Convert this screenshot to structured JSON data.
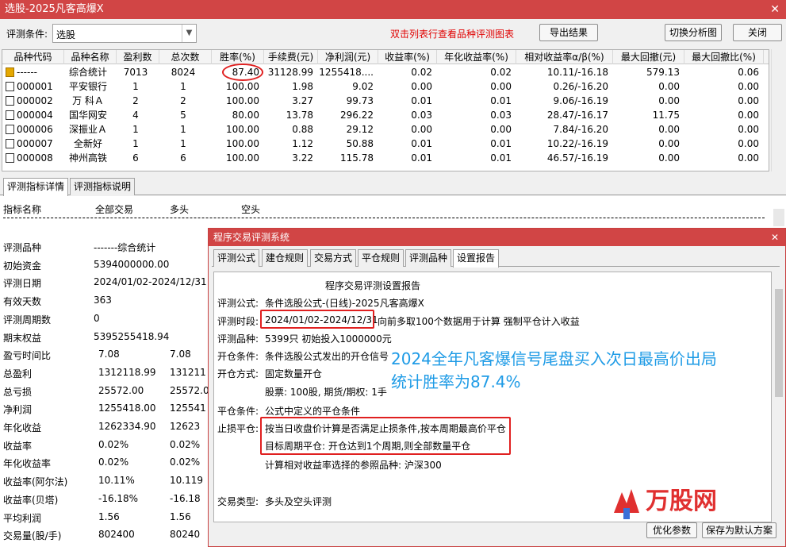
{
  "window": {
    "title": "选股-2025凡客高爆X",
    "close": "✕"
  },
  "toolbar": {
    "label": "评测条件:",
    "select_value": "选股",
    "hint": "双击列表行查看品种评测图表",
    "export_btn": "导出结果",
    "switch_btn": "切换分析图",
    "close_btn": "关闭"
  },
  "grid": {
    "columns": [
      "品种代码",
      "品种名称",
      "盈利数",
      "总次数",
      "胜率(%)",
      "手续费(元)",
      "净利润(元)",
      "收益率(%)",
      "年化收益率(%)",
      "相对收益率α/β(%)",
      "最大回撤(元)",
      "最大回撤比(%)"
    ],
    "rows": [
      {
        "code": "------",
        "name": "综合统计",
        "win": "7013",
        "total": "8024",
        "rate": "87.40",
        "fee": "31128.99",
        "profit": "1255418....",
        "ret": "0.02",
        "annual": "0.02",
        "alpha": "10.11/-16.18",
        "maxdd": "579.13",
        "ddratio": "0.06",
        "summary": true
      },
      {
        "code": "000001",
        "name": "平安银行",
        "win": "1",
        "total": "1",
        "rate": "100.00",
        "fee": "1.98",
        "profit": "9.02",
        "ret": "0.00",
        "annual": "0.00",
        "alpha": "0.26/-16.20",
        "maxdd": "0.00",
        "ddratio": "0.00"
      },
      {
        "code": "000002",
        "name": "万 科Ａ",
        "win": "2",
        "total": "2",
        "rate": "100.00",
        "fee": "3.27",
        "profit": "99.73",
        "ret": "0.01",
        "annual": "0.01",
        "alpha": "9.06/-16.19",
        "maxdd": "0.00",
        "ddratio": "0.00"
      },
      {
        "code": "000004",
        "name": "国华网安",
        "win": "4",
        "total": "5",
        "rate": "80.00",
        "fee": "13.78",
        "profit": "296.22",
        "ret": "0.03",
        "annual": "0.03",
        "alpha": "28.47/-16.17",
        "maxdd": "11.75",
        "ddratio": "0.00"
      },
      {
        "code": "000006",
        "name": "深振业Ａ",
        "win": "1",
        "total": "1",
        "rate": "100.00",
        "fee": "0.88",
        "profit": "29.12",
        "ret": "0.00",
        "annual": "0.00",
        "alpha": "7.84/-16.20",
        "maxdd": "0.00",
        "ddratio": "0.00"
      },
      {
        "code": "000007",
        "name": "全新好",
        "win": "1",
        "total": "1",
        "rate": "100.00",
        "fee": "1.12",
        "profit": "50.88",
        "ret": "0.01",
        "annual": "0.01",
        "alpha": "10.22/-16.19",
        "maxdd": "0.00",
        "ddratio": "0.00"
      },
      {
        "code": "000008",
        "name": "神州高铁",
        "win": "6",
        "total": "6",
        "rate": "100.00",
        "fee": "3.22",
        "profit": "115.78",
        "ret": "0.01",
        "annual": "0.01",
        "alpha": "46.57/-16.19",
        "maxdd": "0.00",
        "ddratio": "0.00"
      }
    ]
  },
  "bottom_tabs": [
    "评测指标详情",
    "评测指标说明"
  ],
  "detail": {
    "headers": [
      "指标名称",
      "全部交易",
      "多头",
      "空头"
    ],
    "rows": [
      {
        "label": "评测品种",
        "v1": "-------综合统计",
        "v2": ""
      },
      {
        "label": "初始资金",
        "v1": "5394000000.00",
        "v2": ""
      },
      {
        "label": "评测日期",
        "v1": "2024/01/02-2024/12/31",
        "v2": ""
      },
      {
        "label": "有效天数",
        "v1": "363",
        "v2": ""
      },
      {
        "label": "评测周期数",
        "v1": "0",
        "v2": ""
      },
      {
        "label": "期末权益",
        "v1": "5395255418.94",
        "v2": ""
      },
      {
        "label": "盈亏时间比",
        "v1": "7.08",
        "v2": "7.08"
      },
      {
        "label": "总盈利",
        "v1": "1312118.99",
        "v2": "131211"
      },
      {
        "label": "总亏损",
        "v1": "25572.00",
        "v2": "25572.0"
      },
      {
        "label": "净利润",
        "v1": "1255418.00",
        "v2": "125541"
      },
      {
        "label": "年化收益",
        "v1": "1262334.90",
        "v2": "12623"
      },
      {
        "label": "收益率",
        "v1": "0.02%",
        "v2": "0.02%"
      },
      {
        "label": "年化收益率",
        "v1": "0.02%",
        "v2": "0.02%"
      },
      {
        "label": "收益率(阿尔法)",
        "v1": "10.11%",
        "v2": "10.119"
      },
      {
        "label": "收益率(贝塔)",
        "v1": "-16.18%",
        "v2": "-16.18"
      },
      {
        "label": "平均利润",
        "v1": "1.56",
        "v2": "1.56"
      },
      {
        "label": "交易量(股/手)",
        "v1": "802400",
        "v2": "80240"
      }
    ]
  },
  "dialog": {
    "title": "程序交易评测系统",
    "close": "✕",
    "tabs": [
      "评测公式",
      "建仓规则",
      "交易方式",
      "平仓规则",
      "评测品种",
      "设置报告"
    ],
    "report": {
      "heading": "程序交易评测设置报告",
      "formula_label": "评测公式:",
      "formula": "条件选股公式-(日线)-2025凡客高爆X",
      "period_label": "评测时段:",
      "period": "2024/01/02-2024/12/31",
      "period_suffix": "向前多取100个数据用于计算 强制平仓计入收益",
      "varieties_label": "评测品种:",
      "varieties": "5399只 初始投入1000000元",
      "open_cond_label": "开仓条件:",
      "open_cond": "条件选股公式发出的开仓信号",
      "open_mode_label": "开仓方式:",
      "open_mode": "固定数量开仓",
      "open_mode_sub": "股票: 100股, 期货/期权: 1手",
      "close_cond_label": "平仓条件:",
      "close_cond": "公式中定义的平仓条件",
      "stop_label": "止损平仓:",
      "stop_line1": "按当日收盘价计算是否满足止损条件,按本周期最高价平仓",
      "stop_line2": "目标周期平仓: 开仓达到1个周期,则全部数量平仓",
      "ref": "计算相对收益率选择的参照品种: 沪深300",
      "trade_type_label": "交易类型:",
      "trade_type": "多头及空头评测"
    },
    "btn_optimize": "优化参数",
    "btn_save": "保存为默认方案"
  },
  "annotation": {
    "line1": "2024全年凡客爆信号尾盘买入次日最高价出局",
    "line2": "统计胜率为87.4%"
  },
  "logo": {
    "text": "万股网"
  },
  "colors": {
    "title_bar": "#d14545",
    "highlight": "#e02020",
    "annotation": "#1e9be6",
    "hint": "#e00000"
  }
}
